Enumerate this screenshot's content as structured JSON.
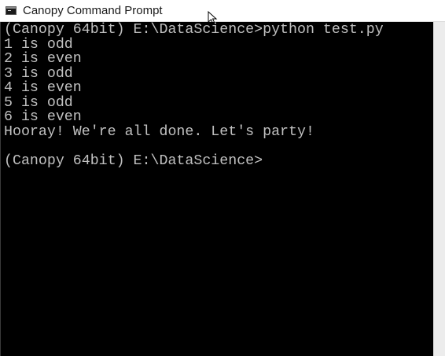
{
  "window": {
    "title": "Canopy Command Prompt",
    "icon": "command-prompt-icon"
  },
  "console": {
    "background": "#000000",
    "text_color": "#c0c0c0",
    "lines": [
      "(Canopy 64bit) E:\\DataScience>python test.py",
      "1 is odd",
      "2 is even",
      "3 is odd",
      "4 is even",
      "5 is odd",
      "6 is even",
      "Hooray! We're all done. Let's party!",
      "",
      "(Canopy 64bit) E:\\DataScience>"
    ]
  },
  "scrollbar": {
    "icon": "vertical-scrollbar"
  }
}
